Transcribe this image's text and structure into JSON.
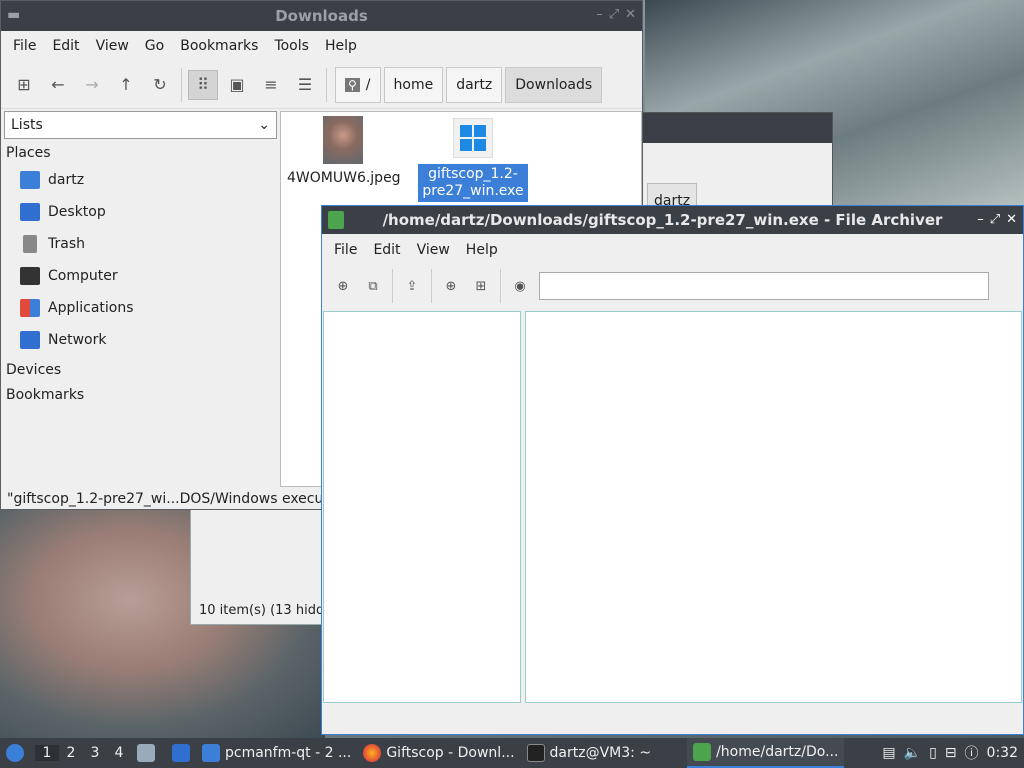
{
  "back_window_1": {
    "status": "10 item(s) (13 hidd"
  },
  "back_window_2": {
    "crumb": "dartz"
  },
  "file_manager": {
    "title": "Downloads",
    "menu": [
      "File",
      "Edit",
      "View",
      "Go",
      "Bookmarks",
      "Tools",
      "Help"
    ],
    "breadcrumb": {
      "root": "/",
      "items": [
        "home",
        "dartz",
        "Downloads"
      ]
    },
    "side_select": "Lists",
    "sections": {
      "places": "Places",
      "devices": "Devices",
      "bookmarks": "Bookmarks"
    },
    "places": [
      "dartz",
      "Desktop",
      "Trash",
      "Computer",
      "Applications",
      "Network"
    ],
    "files": [
      {
        "name": "4WOMUW6.jpeg"
      },
      {
        "name_line1": "giftscop_1.2-",
        "name_line2": "pre27_win.exe"
      }
    ],
    "status": "\"giftscop_1.2-pre27_wi...DOS/Windows execu"
  },
  "archiver": {
    "title": "/home/dartz/Downloads/giftscop_1.2-pre27_win.exe - File Archiver",
    "menu": [
      "File",
      "Edit",
      "View",
      "Help"
    ],
    "search_value": ""
  },
  "taskbar": {
    "workspaces": [
      "1",
      "2",
      "3",
      "4"
    ],
    "tasks": [
      "pcmanfm-qt - 2 ...",
      "Giftscop - Downl...",
      "dartz@VM3: ~",
      "/home/dartz/Do..."
    ],
    "clock": "0:32"
  },
  "colors": {
    "accent": "#3c7fd8",
    "titlebar": "#3b4046"
  }
}
